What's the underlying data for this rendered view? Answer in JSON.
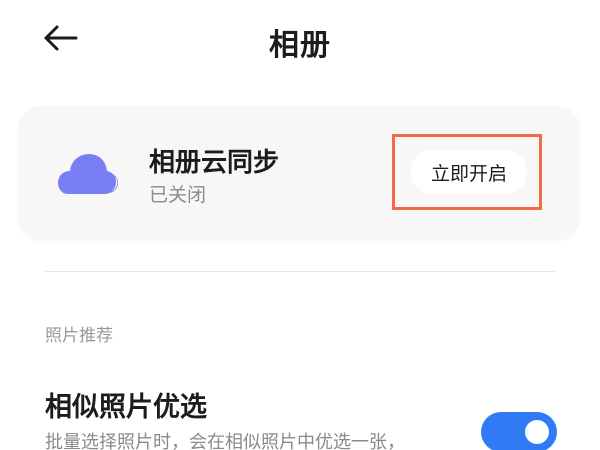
{
  "header": {
    "title": "相册",
    "back_icon": "arrow-left-icon"
  },
  "sync_card": {
    "icon": "cloud-icon",
    "icon_color": "#7a7ef5",
    "title": "相册云同步",
    "status": "已关闭",
    "button_label": "立即开启",
    "highlight_color": "#f26b48"
  },
  "section": {
    "label": "照片推荐"
  },
  "similar_photos": {
    "title": "相似照片优选",
    "description": "批量选择照片时，会在相似照片中优选一张，",
    "toggle_on": true,
    "toggle_color": "#2f7bf6"
  }
}
